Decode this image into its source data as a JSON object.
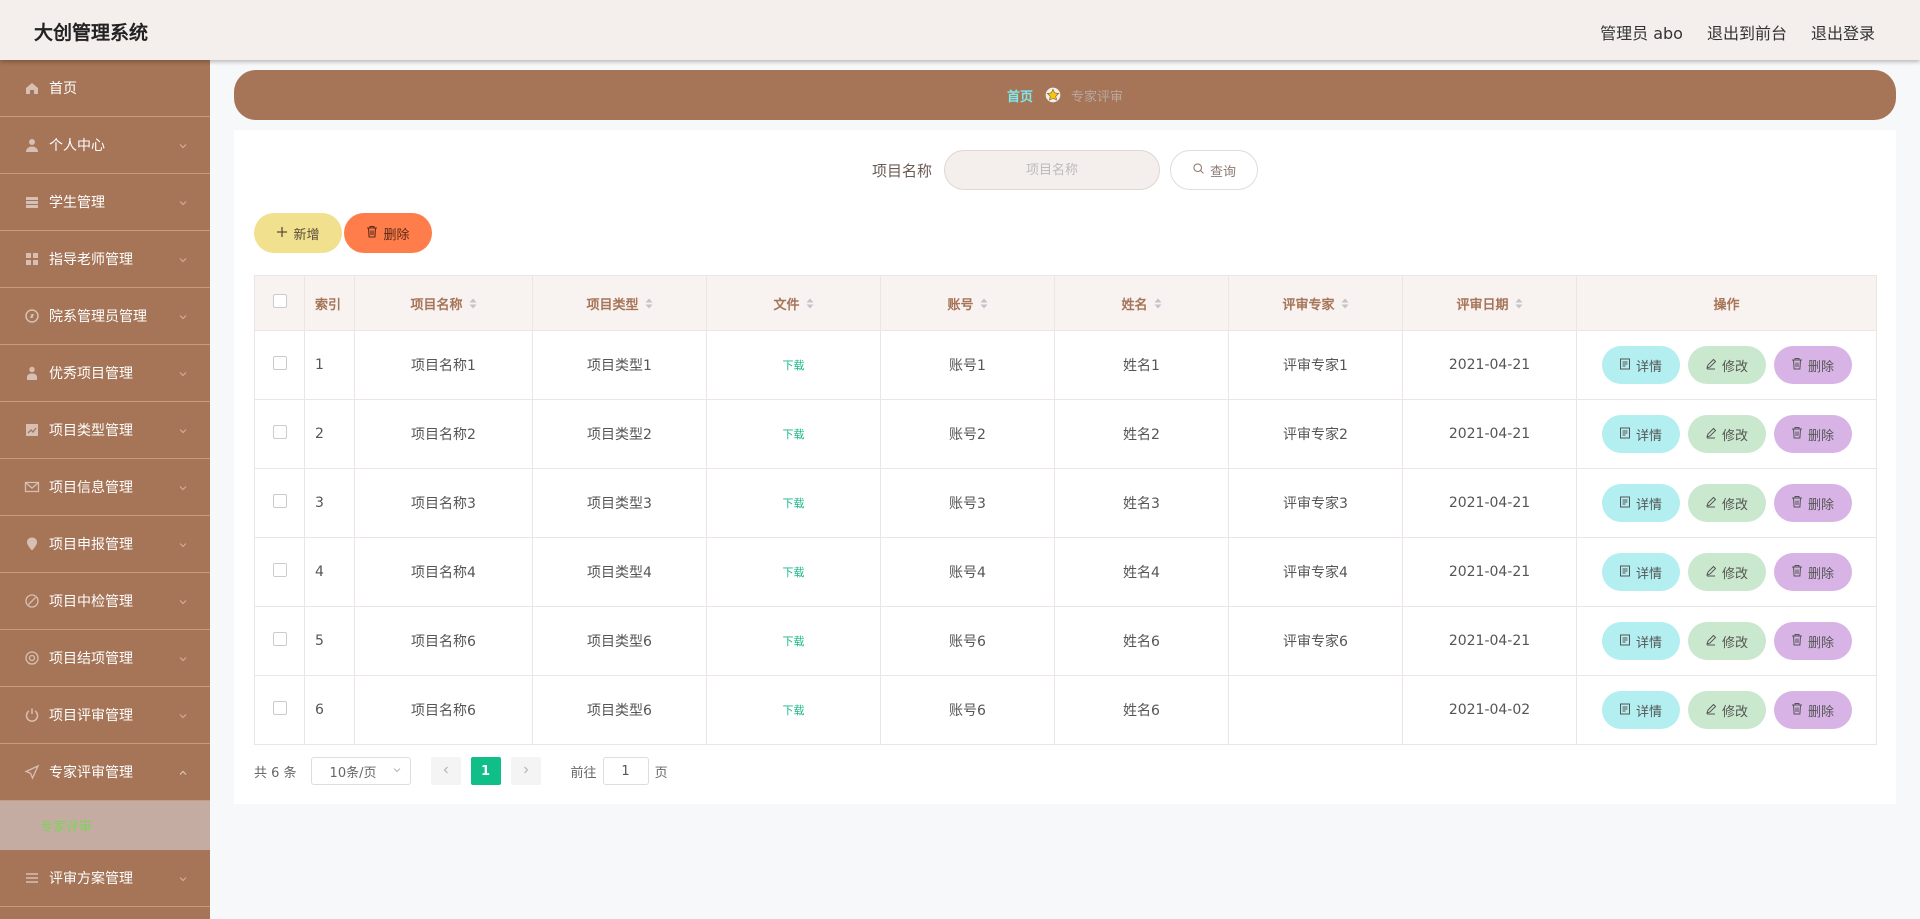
{
  "header": {
    "title": "大创管理系统",
    "user": "管理员 abo",
    "to_front": "退出到前台",
    "logout": "退出登录"
  },
  "sidebar": {
    "items": [
      {
        "label": "首页",
        "icon": "home-icon"
      },
      {
        "label": "个人中心",
        "icon": "user-icon"
      },
      {
        "label": "学生管理",
        "icon": "student-icon"
      },
      {
        "label": "指导老师管理",
        "icon": "grid-icon"
      },
      {
        "label": "院系管理员管理",
        "icon": "compass-icon"
      },
      {
        "label": "优秀项目管理",
        "icon": "person-icon"
      },
      {
        "label": "项目类型管理",
        "icon": "chart-icon"
      },
      {
        "label": "项目信息管理",
        "icon": "mail-icon"
      },
      {
        "label": "项目申报管理",
        "icon": "pin-icon"
      },
      {
        "label": "项目中检管理",
        "icon": "edit-icon"
      },
      {
        "label": "项目结项管理",
        "icon": "globe-icon"
      },
      {
        "label": "项目评审管理",
        "icon": "power-icon"
      },
      {
        "label": "专家评审管理",
        "icon": "send-icon"
      }
    ],
    "submenu_label": "专家评审",
    "last_item": {
      "label": "评审方案管理",
      "icon": "list-icon"
    }
  },
  "breadcrumb": {
    "home": "首页",
    "current": "专家评审"
  },
  "search": {
    "label": "项目名称",
    "placeholder": "项目名称",
    "button": "查询"
  },
  "toolbar": {
    "add_label": "新增",
    "delete_label": "删除"
  },
  "table": {
    "headers": [
      "索引",
      "项目名称",
      "项目类型",
      "文件",
      "账号",
      "姓名",
      "评审专家",
      "评审日期",
      "操作"
    ],
    "rows": [
      {
        "index": "1",
        "name": "项目名称1",
        "type": "项目类型1",
        "file": "下载",
        "account": "账号1",
        "person": "姓名1",
        "expert": "评审专家1",
        "date": "2021-04-21"
      },
      {
        "index": "2",
        "name": "项目名称2",
        "type": "项目类型2",
        "file": "下载",
        "account": "账号2",
        "person": "姓名2",
        "expert": "评审专家2",
        "date": "2021-04-21"
      },
      {
        "index": "3",
        "name": "项目名称3",
        "type": "项目类型3",
        "file": "下载",
        "account": "账号3",
        "person": "姓名3",
        "expert": "评审专家3",
        "date": "2021-04-21"
      },
      {
        "index": "4",
        "name": "项目名称4",
        "type": "项目类型4",
        "file": "下载",
        "account": "账号4",
        "person": "姓名4",
        "expert": "评审专家4",
        "date": "2021-04-21"
      },
      {
        "index": "5",
        "name": "项目名称6",
        "type": "项目类型6",
        "file": "下载",
        "account": "账号6",
        "person": "姓名6",
        "expert": "评审专家6",
        "date": "2021-04-21"
      },
      {
        "index": "6",
        "name": "项目名称6",
        "type": "项目类型6",
        "file": "下载",
        "account": "账号6",
        "person": "姓名6",
        "expert": "",
        "date": "2021-04-02"
      }
    ],
    "op_detail": "详情",
    "op_edit": "修改",
    "op_delete": "删除"
  },
  "pagination": {
    "total": "共 6 条",
    "page_size": "10条/页",
    "current_page": "1",
    "goto_label": "前往",
    "goto_value": "1",
    "page_suffix": "页"
  },
  "colors": {
    "sidebar_bg": "#a67457",
    "header_bg": "#f4eeec",
    "accent_green": "#0fbf87",
    "add_btn": "#f1e18e",
    "del_btn": "#ff7d4a"
  }
}
